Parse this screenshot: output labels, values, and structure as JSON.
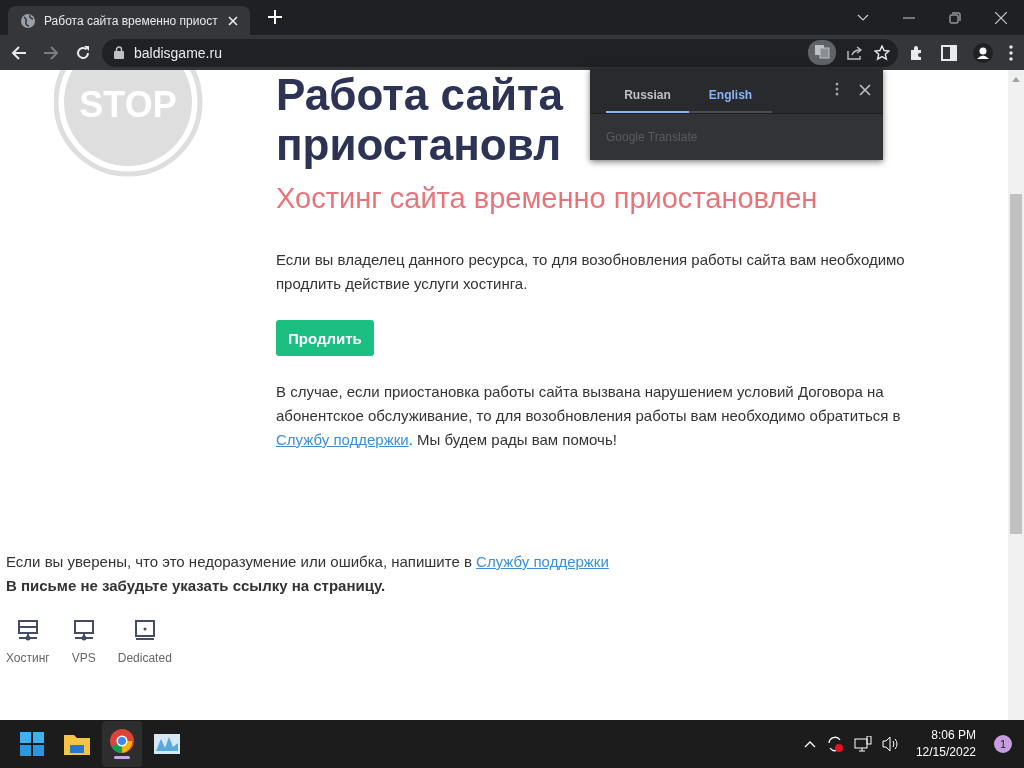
{
  "browser": {
    "tab": {
      "title": "Работа сайта временно приост"
    },
    "address": "baldisgame.ru"
  },
  "translate_popup": {
    "tabs": [
      {
        "label": "Russian",
        "selected": true
      },
      {
        "label": "English",
        "selected": false
      }
    ],
    "footer": "Google Translate"
  },
  "page": {
    "logo_text": "STOP",
    "heading_lines": [
      "Работа сайта",
      "приостановл"
    ],
    "subheading": "Хостинг сайта временно приостановлен",
    "paragraph_1": "Если вы владелец данного ресурса, то для возобновления работы сайта вам необходимо продлить действие услуги хостинга.",
    "renew_button": "Продлить",
    "paragraph_2": {
      "before": "В случае, если приостановка работы сайта вызвана нарушением условий Договора на абонентское обслуживание, то для возобновления работы вам необходимо обратиться в",
      "link": "Службу поддержки",
      "after": ". Мы будем рады вам помочь!"
    },
    "notice": {
      "text": "Если вы уверены, что это недоразумение или ошибка, напишите в",
      "link": "Службу поддержки"
    },
    "bold_note": "В письме не забудьте указать ссылку на страницу.",
    "services": [
      {
        "label": "Хостинг",
        "kind": "server"
      },
      {
        "label": "VPS",
        "kind": "monitor"
      },
      {
        "label": "Dedicated",
        "kind": "dedicated"
      }
    ]
  },
  "taskbar": {
    "time": "8:06 PM",
    "date": "12/15/2022",
    "notification_count": "1"
  }
}
